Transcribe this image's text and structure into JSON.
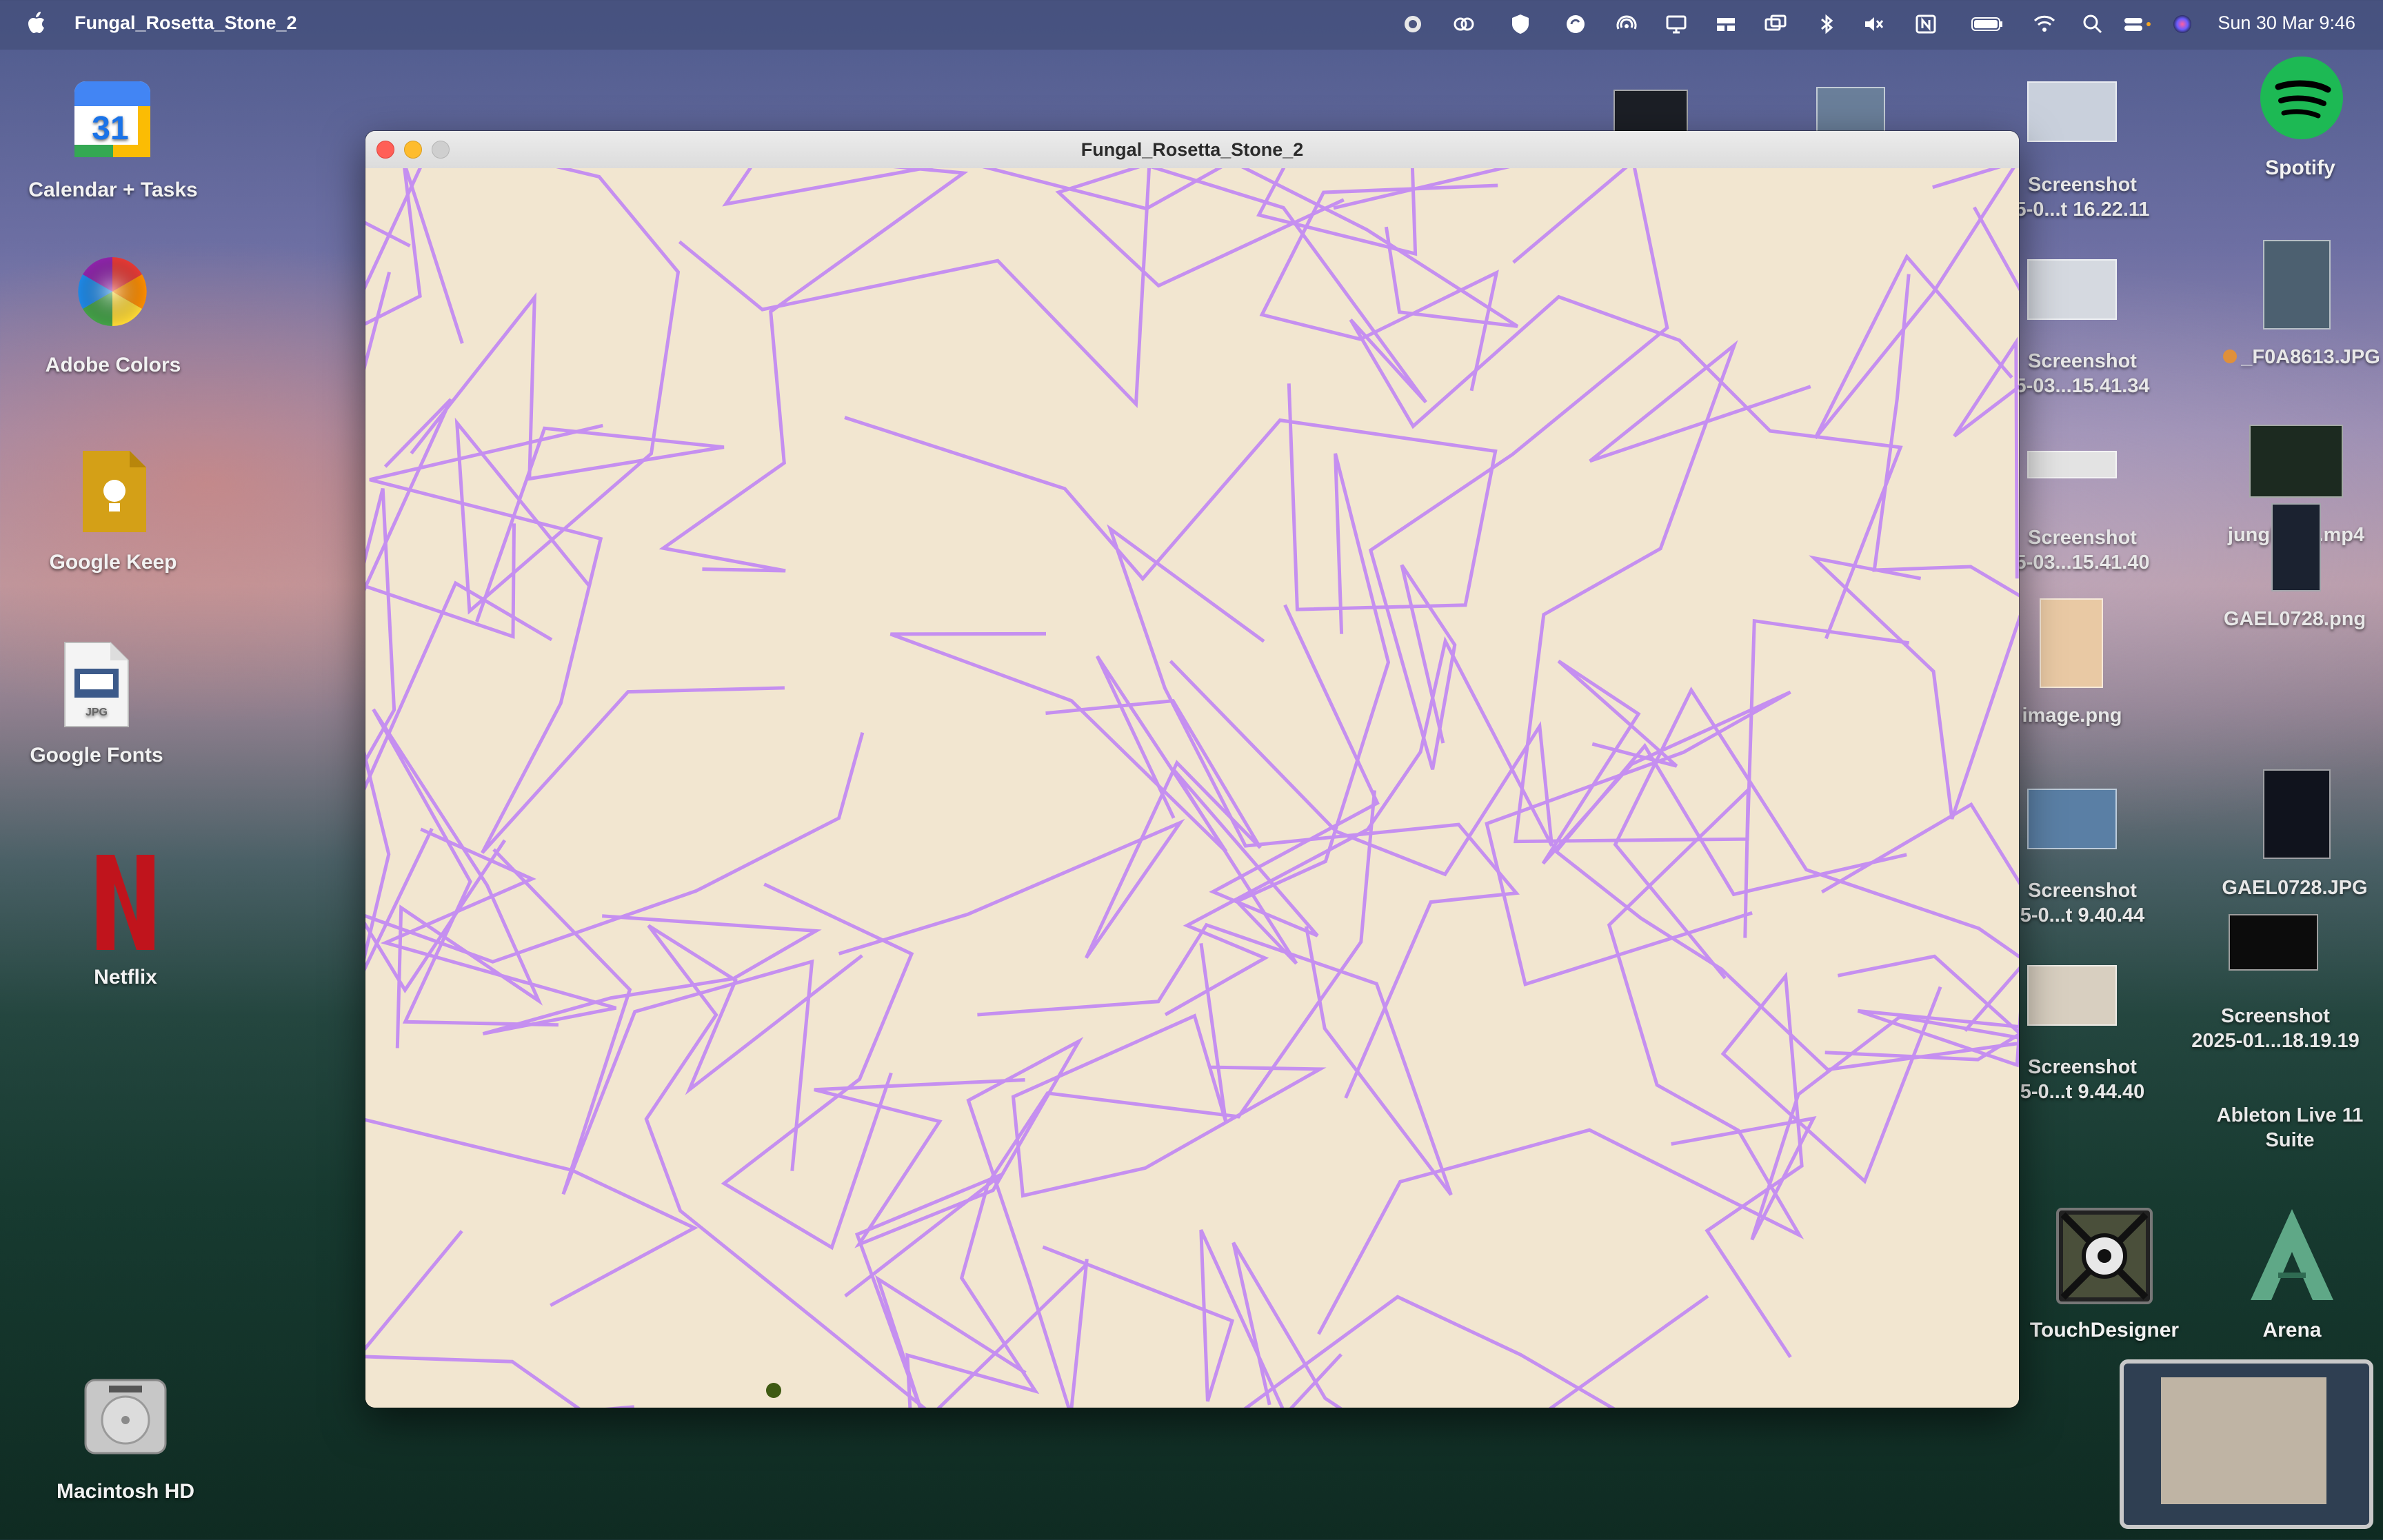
{
  "menubar": {
    "app_name": "Fungal_Rosetta_Stone_2",
    "clock": "Sun 30 Mar  9:46"
  },
  "window": {
    "title": "Fungal_Rosetta_Stone_2",
    "canvas_bg": "#f2e6d0",
    "stroke_color": "#c58ff0",
    "dot_color": "#3f5a12"
  },
  "desktop_left": [
    {
      "label": "Calendar + Tasks"
    },
    {
      "label": "Adobe Colors"
    },
    {
      "label": "Google Keep"
    },
    {
      "label": "Google Fonts"
    },
    {
      "label": "Netflix"
    },
    {
      "label": "Macintosh HD"
    }
  ],
  "desktop_right": {
    "spotify": "Spotify",
    "f0a": "_F0A8613.JPG",
    "jungle": "jungle crt.mp4",
    "gael_png": "GAEL0728.png",
    "gael_jpg": "GAEL0728.JPG",
    "screenshot_2025_line1": "Screenshot",
    "screenshot_2025_line2": "2025-01...18.19.19",
    "ableton_line1": "Ableton Live 11",
    "ableton_line2": "Suite",
    "touchdesigner": "TouchDesigner",
    "arena": "Arena",
    "shots": [
      {
        "l1": "Screenshot",
        "l2": "5-0...t 16.22.11"
      },
      {
        "l1": "Screenshot",
        "l2": "5-03...15.41.34"
      },
      {
        "l1": "Screenshot",
        "l2": "5-03...15.41.40"
      },
      {
        "l1": "image.png",
        "l2": ""
      },
      {
        "l1": "Screenshot",
        "l2": "5-0...t 9.40.44"
      },
      {
        "l1": "Screenshot",
        "l2": "5-0...t 9.44.40"
      }
    ]
  },
  "icons": {
    "menubar": [
      "record-icon",
      "creative-cloud-icon",
      "shield-icon",
      "sync-icon",
      "airdrop-icon",
      "display-icon",
      "stage-manager-icon",
      "screen-mirroring-icon",
      "bluetooth-icon",
      "mute-icon",
      "input-source-icon",
      "battery-icon",
      "wifi-icon",
      "spotlight-icon",
      "control-center-icon",
      "siri-icon"
    ]
  }
}
